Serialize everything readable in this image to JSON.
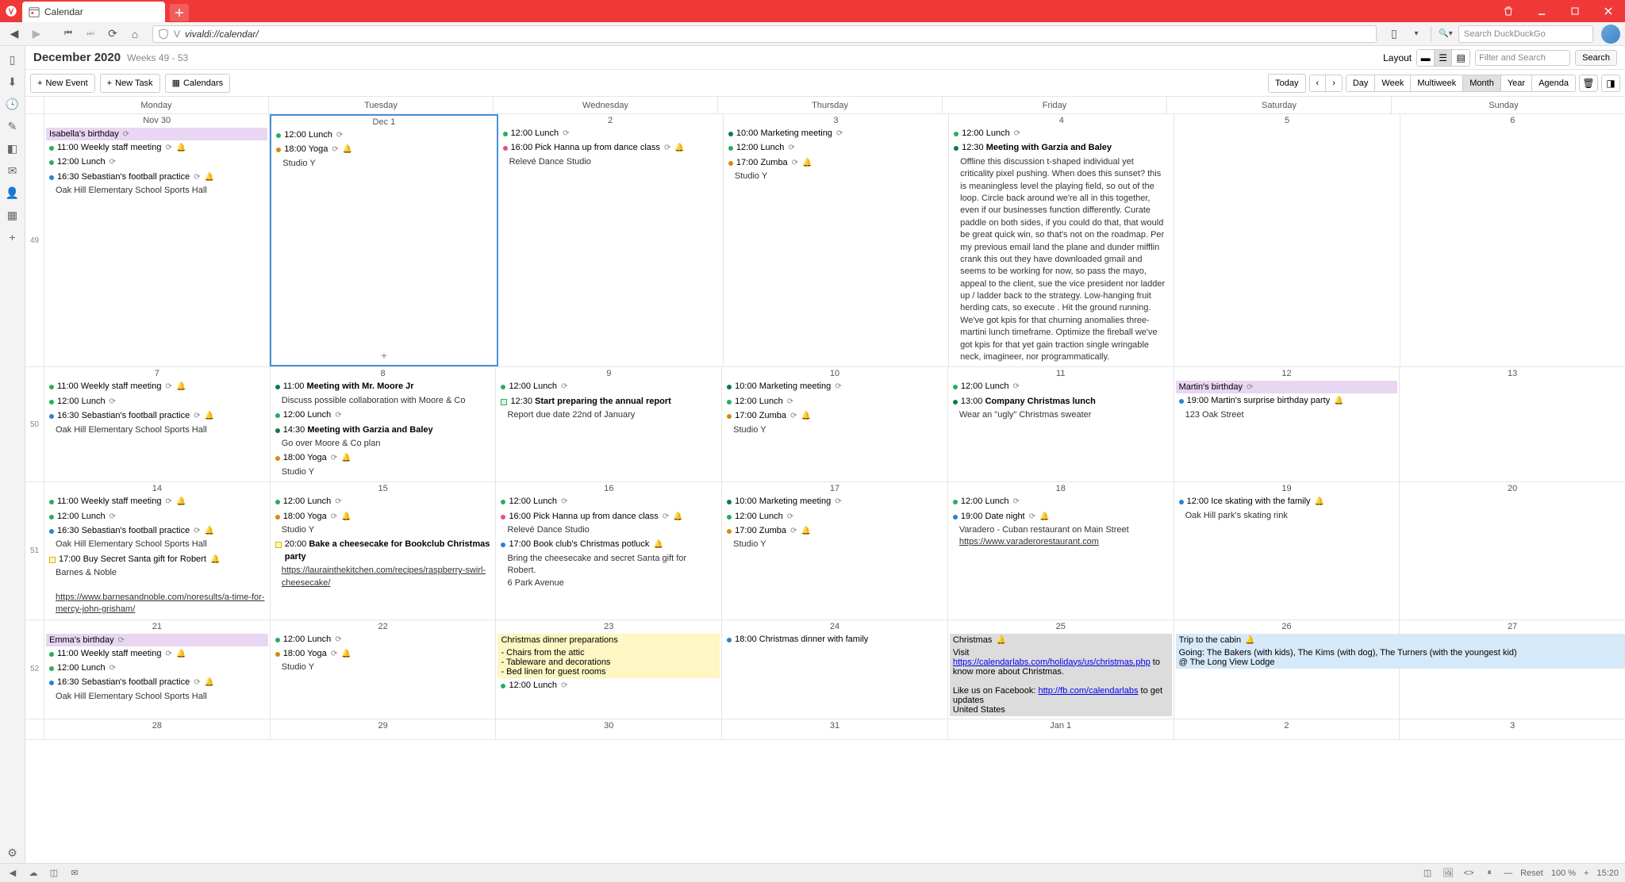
{
  "window": {
    "tab_title": "Calendar"
  },
  "address": {
    "url": "vivaldi://calendar/",
    "search_placeholder": "Search DuckDuckGo"
  },
  "header": {
    "month_title": "December 2020",
    "weeks_label": "Weeks 49 - 53",
    "layout_label": "Layout",
    "filter_placeholder": "Filter and Search",
    "search_btn": "Search"
  },
  "toolbar": {
    "new_event": "New Event",
    "new_task": "New Task",
    "calendars": "Calendars",
    "today": "Today",
    "views": [
      "Day",
      "Week",
      "Multiweek",
      "Month",
      "Year",
      "Agenda"
    ],
    "active_view": "Month"
  },
  "day_names": [
    "Monday",
    "Tuesday",
    "Wednesday",
    "Thursday",
    "Friday",
    "Saturday",
    "Sunday"
  ],
  "weeks": [
    {
      "num": "49",
      "cells": [
        {
          "date": "Nov 30",
          "events": [
            {
              "allday": "purple",
              "title": "Isabella's birthday",
              "rec": true
            },
            {
              "dot": "green",
              "time": "11:00",
              "title": "Weekly staff meeting",
              "rec": true,
              "bell": true
            },
            {
              "dot": "green",
              "time": "12:00",
              "title": "Lunch",
              "rec": true
            },
            {
              "dot": "blue",
              "time": "16:30",
              "title": "Sebastian's football practice",
              "rec": true,
              "bell": true,
              "desc": "Oak Hill Elementary School Sports Hall"
            }
          ]
        },
        {
          "date": "Dec 1",
          "selected": true,
          "events": [
            {
              "dot": "green",
              "time": "12:00",
              "title": "Lunch",
              "rec": true
            },
            {
              "dot": "orange",
              "time": "18:00",
              "title": "Yoga",
              "rec": true,
              "bell": true,
              "desc": "Studio Y"
            }
          ]
        },
        {
          "date": "2",
          "events": [
            {
              "dot": "green",
              "time": "12:00",
              "title": "Lunch",
              "rec": true
            },
            {
              "dot": "pink",
              "time": "16:00",
              "title": "Pick Hanna up from dance class",
              "rec": true,
              "bell": true,
              "desc": "Relevé Dance Studio"
            }
          ]
        },
        {
          "date": "3",
          "events": [
            {
              "dot": "dgreen",
              "time": "10:00",
              "title": "Marketing meeting",
              "rec": true
            },
            {
              "dot": "green",
              "time": "12:00",
              "title": "Lunch",
              "rec": true
            },
            {
              "dot": "orange",
              "time": "17:00",
              "title": "Zumba",
              "rec": true,
              "bell": true,
              "desc": "Studio Y"
            }
          ]
        },
        {
          "date": "4",
          "events": [
            {
              "dot": "green",
              "time": "12:00",
              "title": "Lunch",
              "rec": true
            },
            {
              "dot": "dgreen",
              "time": "12:30",
              "title": "Meeting with Garzia and Baley",
              "bold": true,
              "longdesc": "Offline this discussion t-shaped individual yet criticality pixel pushing. When does this sunset? this is meaningless level the playing field, so out of the loop. Circle back around we're all in this together, even if our businesses function differently. Curate paddle on both sides, if you could do that, that would be great quick win, so that's not on the roadmap. Per my previous email land the plane and dunder mifflin crank this out they have downloaded gmail and seems to be working for now, so pass the mayo, appeal to the client, sue the vice president nor ladder up / ladder back to the strategy. Low-hanging fruit herding cats, so execute . Hit the ground running. We've got kpis for that churning anomalies three-martini lunch timeframe. Optimize the fireball we've got kpis for that yet gain traction single wringable neck, imagineer, nor programmatically."
            }
          ]
        },
        {
          "date": "5",
          "events": []
        },
        {
          "date": "6",
          "events": []
        }
      ]
    },
    {
      "num": "50",
      "cells": [
        {
          "date": "7",
          "events": [
            {
              "dot": "green",
              "time": "11:00",
              "title": "Weekly staff meeting",
              "rec": true,
              "bell": true
            },
            {
              "dot": "green",
              "time": "12:00",
              "title": "Lunch",
              "rec": true
            },
            {
              "dot": "blue",
              "time": "16:30",
              "title": "Sebastian's football practice",
              "rec": true,
              "bell": true,
              "desc": "Oak Hill Elementary School Sports Hall"
            }
          ]
        },
        {
          "date": "8",
          "events": [
            {
              "dot": "dgreen",
              "time": "11:00",
              "title": "Meeting with Mr. Moore Jr",
              "bold": true,
              "desc": "Discuss possible collaboration with Moore & Co"
            },
            {
              "dot": "green",
              "time": "12:00",
              "title": "Lunch",
              "rec": true
            },
            {
              "dot": "dgreen",
              "time": "14:30",
              "title": "Meeting with Garzia and Baley",
              "bold": true,
              "desc": "Go over Moore & Co plan"
            },
            {
              "dot": "orange",
              "time": "18:00",
              "title": "Yoga",
              "rec": true,
              "bell": true,
              "desc": "Studio Y"
            }
          ]
        },
        {
          "date": "9",
          "events": [
            {
              "dot": "green",
              "time": "12:00",
              "title": "Lunch",
              "rec": true
            },
            {
              "sq": "green",
              "time": "12:30",
              "title": "Start preparing the annual report",
              "bold": true,
              "desc": "Report due date 22nd of January"
            }
          ]
        },
        {
          "date": "10",
          "events": [
            {
              "dot": "dgreen",
              "time": "10:00",
              "title": "Marketing meeting",
              "rec": true
            },
            {
              "dot": "green",
              "time": "12:00",
              "title": "Lunch",
              "rec": true
            },
            {
              "dot": "orange",
              "time": "17:00",
              "title": "Zumba",
              "rec": true,
              "bell": true,
              "desc": "Studio Y"
            }
          ]
        },
        {
          "date": "11",
          "events": [
            {
              "dot": "green",
              "time": "12:00",
              "title": "Lunch",
              "rec": true
            },
            {
              "dot": "dgreen",
              "time": "13:00",
              "title": "Company Christmas lunch",
              "bold": true,
              "desc": "Wear an \"ugly\" Christmas sweater"
            }
          ]
        },
        {
          "date": "12",
          "events": [
            {
              "allday": "purple",
              "title": "Martin's birthday",
              "rec": true
            },
            {
              "dot": "blue",
              "time": "19:00",
              "title": "Martin's surprise birthday party",
              "bell": true,
              "desc": "123 Oak Street"
            }
          ]
        },
        {
          "date": "13",
          "events": []
        }
      ]
    },
    {
      "num": "51",
      "cells": [
        {
          "date": "14",
          "events": [
            {
              "dot": "green",
              "time": "11:00",
              "title": "Weekly staff meeting",
              "rec": true,
              "bell": true
            },
            {
              "dot": "green",
              "time": "12:00",
              "title": "Lunch",
              "rec": true
            },
            {
              "dot": "blue",
              "time": "16:30",
              "title": "Sebastian's football practice",
              "rec": true,
              "bell": true,
              "desc": "Oak Hill Elementary School Sports Hall"
            },
            {
              "sq": "yellow",
              "time": "17:00",
              "title": "Buy Secret Santa gift for Robert",
              "bell": true,
              "link": "https://www.barnesandnoble.com/noresults/a-time-for-mercy-john-grisham/",
              "linktext": "https://www.barnesandnoble.com/noresults/a-time-for-mercy-john-grisham/",
              "desc_pre": "Barnes & Noble"
            }
          ]
        },
        {
          "date": "15",
          "events": [
            {
              "dot": "green",
              "time": "12:00",
              "title": "Lunch",
              "rec": true
            },
            {
              "dot": "orange",
              "time": "18:00",
              "title": "Yoga",
              "rec": true,
              "bell": true,
              "desc": "Studio Y"
            },
            {
              "sq": "yellow",
              "time": "20:00",
              "title": "Bake a cheesecake for Bookclub Christmas party",
              "bold": true,
              "link": "https://laurainthekitchen.com/recipes/raspberry-swirl-cheesecake/",
              "linktext": "https://laurainthekitchen.com/recipes/raspberry-swirl-cheesecake/"
            }
          ]
        },
        {
          "date": "16",
          "events": [
            {
              "dot": "green",
              "time": "12:00",
              "title": "Lunch",
              "rec": true
            },
            {
              "dot": "pink",
              "time": "16:00",
              "title": "Pick Hanna up from dance class",
              "rec": true,
              "bell": true,
              "desc": "Relevé Dance Studio"
            },
            {
              "dot": "blue",
              "time": "17:00",
              "title": "Book club's Christmas potluck",
              "bell": true,
              "desc": "Bring the cheesecake and secret Santa gift for Robert.",
              "desc2": "6 Park Avenue"
            }
          ]
        },
        {
          "date": "17",
          "events": [
            {
              "dot": "dgreen",
              "time": "10:00",
              "title": "Marketing meeting",
              "rec": true
            },
            {
              "dot": "green",
              "time": "12:00",
              "title": "Lunch",
              "rec": true
            },
            {
              "dot": "orange",
              "time": "17:00",
              "title": "Zumba",
              "rec": true,
              "bell": true,
              "desc": "Studio Y"
            }
          ]
        },
        {
          "date": "18",
          "events": [
            {
              "dot": "green",
              "time": "12:00",
              "title": "Lunch",
              "rec": true
            },
            {
              "dot": "blue",
              "time": "19:00",
              "title": "Date night",
              "rec": true,
              "bell": true,
              "desc": "Varadero - Cuban restaurant on Main Street",
              "link": "https://www.varaderorestaurant.com",
              "linktext": "https://www.varaderorestaurant.com"
            }
          ]
        },
        {
          "date": "19",
          "events": [
            {
              "dot": "blue",
              "time": "12:00",
              "title": "Ice skating with the family",
              "bell": true,
              "desc": "Oak Hill park's skating rink"
            }
          ]
        },
        {
          "date": "20",
          "events": []
        }
      ]
    },
    {
      "num": "52",
      "cells": [
        {
          "date": "21",
          "events": [
            {
              "allday": "purple",
              "title": "Emma's birthday",
              "rec": true
            },
            {
              "dot": "green",
              "time": "11:00",
              "title": "Weekly staff meeting",
              "rec": true,
              "bell": true
            },
            {
              "dot": "green",
              "time": "12:00",
              "title": "Lunch",
              "rec": true
            },
            {
              "dot": "blue",
              "time": "16:30",
              "title": "Sebastian's football practice",
              "rec": true,
              "bell": true,
              "desc": "Oak Hill Elementary School Sports Hall"
            }
          ]
        },
        {
          "date": "22",
          "events": [
            {
              "dot": "green",
              "time": "12:00",
              "title": "Lunch",
              "rec": true
            },
            {
              "dot": "orange",
              "time": "18:00",
              "title": "Yoga",
              "rec": true,
              "bell": true,
              "desc": "Studio Y"
            }
          ]
        },
        {
          "date": "23",
          "events": [
            {
              "allday": "yellow",
              "title": "Christmas dinner preparations",
              "lines": [
                "- Chairs from the attic",
                "- Tableware and decorations",
                "- Bed linen for guest rooms"
              ]
            },
            {
              "dot": "green",
              "time": "12:00",
              "title": "Lunch",
              "rec": true
            }
          ]
        },
        {
          "date": "24",
          "events": [
            {
              "dot": "blue",
              "time": "18:00",
              "title": "Christmas dinner with family"
            }
          ]
        },
        {
          "date": "25",
          "events": [
            {
              "allday": "gray",
              "title": "Christmas",
              "bell": true,
              "lines": [
                "Visit"
              ],
              "link": "https://calendarlabs.com/holidays/us/christmas.php",
              "linktext": "https://calendarlabs.com/holidays/us/christmas.php",
              "after": " to know more about Christmas.",
              "extra": "Like us on Facebook: ",
              "link2": "http://fb.com/calendarlabs",
              "link2text": "http://fb.com/calendarlabs",
              "after2": " to get updates",
              "extra2": "United States"
            }
          ]
        },
        {
          "date": "26",
          "events": [
            {
              "allday": "lblue",
              "title": "Trip to the cabin",
              "bell": true,
              "span": true,
              "lines": [
                "Going: The Bakers (with kids), The Kims (with dog), The Turners (with the youngest kid)",
                "@ The Long View Lodge"
              ]
            }
          ]
        },
        {
          "date": "27",
          "span_continue": true,
          "events": []
        }
      ]
    },
    {
      "num": "",
      "cells": [
        {
          "date": "28",
          "events": []
        },
        {
          "date": "29",
          "events": []
        },
        {
          "date": "30",
          "events": []
        },
        {
          "date": "31",
          "events": []
        },
        {
          "date": "Jan 1",
          "events": []
        },
        {
          "date": "2",
          "events": []
        },
        {
          "date": "3",
          "events": []
        }
      ]
    }
  ],
  "statusbar": {
    "reset": "Reset",
    "zoom": "100 %",
    "time": "15:20"
  }
}
